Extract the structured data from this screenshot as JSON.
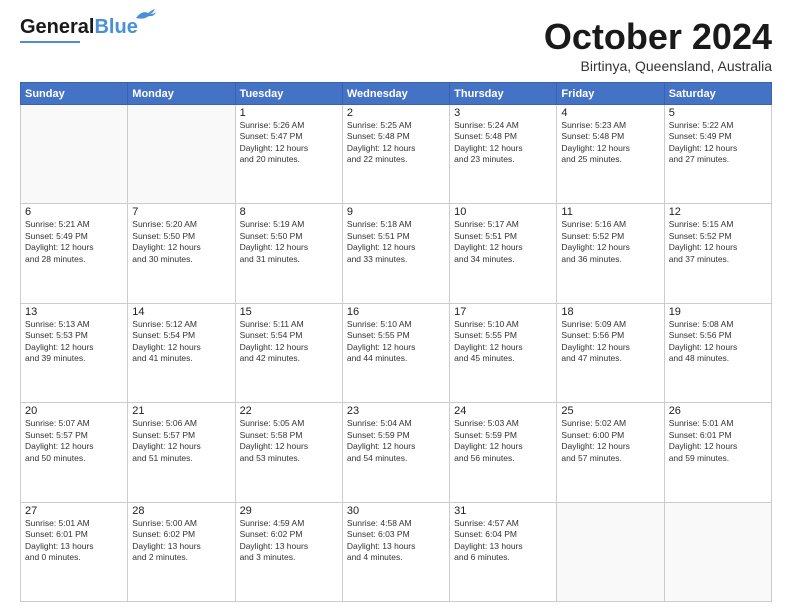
{
  "header": {
    "logo_general": "General",
    "logo_blue": "Blue",
    "month_title": "October 2024",
    "location": "Birtinya, Queensland, Australia"
  },
  "days_of_week": [
    "Sunday",
    "Monday",
    "Tuesday",
    "Wednesday",
    "Thursday",
    "Friday",
    "Saturday"
  ],
  "weeks": [
    [
      {
        "day": "",
        "info": ""
      },
      {
        "day": "",
        "info": ""
      },
      {
        "day": "1",
        "info": "Sunrise: 5:26 AM\nSunset: 5:47 PM\nDaylight: 12 hours\nand 20 minutes."
      },
      {
        "day": "2",
        "info": "Sunrise: 5:25 AM\nSunset: 5:48 PM\nDaylight: 12 hours\nand 22 minutes."
      },
      {
        "day": "3",
        "info": "Sunrise: 5:24 AM\nSunset: 5:48 PM\nDaylight: 12 hours\nand 23 minutes."
      },
      {
        "day": "4",
        "info": "Sunrise: 5:23 AM\nSunset: 5:48 PM\nDaylight: 12 hours\nand 25 minutes."
      },
      {
        "day": "5",
        "info": "Sunrise: 5:22 AM\nSunset: 5:49 PM\nDaylight: 12 hours\nand 27 minutes."
      }
    ],
    [
      {
        "day": "6",
        "info": "Sunrise: 5:21 AM\nSunset: 5:49 PM\nDaylight: 12 hours\nand 28 minutes."
      },
      {
        "day": "7",
        "info": "Sunrise: 5:20 AM\nSunset: 5:50 PM\nDaylight: 12 hours\nand 30 minutes."
      },
      {
        "day": "8",
        "info": "Sunrise: 5:19 AM\nSunset: 5:50 PM\nDaylight: 12 hours\nand 31 minutes."
      },
      {
        "day": "9",
        "info": "Sunrise: 5:18 AM\nSunset: 5:51 PM\nDaylight: 12 hours\nand 33 minutes."
      },
      {
        "day": "10",
        "info": "Sunrise: 5:17 AM\nSunset: 5:51 PM\nDaylight: 12 hours\nand 34 minutes."
      },
      {
        "day": "11",
        "info": "Sunrise: 5:16 AM\nSunset: 5:52 PM\nDaylight: 12 hours\nand 36 minutes."
      },
      {
        "day": "12",
        "info": "Sunrise: 5:15 AM\nSunset: 5:52 PM\nDaylight: 12 hours\nand 37 minutes."
      }
    ],
    [
      {
        "day": "13",
        "info": "Sunrise: 5:13 AM\nSunset: 5:53 PM\nDaylight: 12 hours\nand 39 minutes."
      },
      {
        "day": "14",
        "info": "Sunrise: 5:12 AM\nSunset: 5:54 PM\nDaylight: 12 hours\nand 41 minutes."
      },
      {
        "day": "15",
        "info": "Sunrise: 5:11 AM\nSunset: 5:54 PM\nDaylight: 12 hours\nand 42 minutes."
      },
      {
        "day": "16",
        "info": "Sunrise: 5:10 AM\nSunset: 5:55 PM\nDaylight: 12 hours\nand 44 minutes."
      },
      {
        "day": "17",
        "info": "Sunrise: 5:10 AM\nSunset: 5:55 PM\nDaylight: 12 hours\nand 45 minutes."
      },
      {
        "day": "18",
        "info": "Sunrise: 5:09 AM\nSunset: 5:56 PM\nDaylight: 12 hours\nand 47 minutes."
      },
      {
        "day": "19",
        "info": "Sunrise: 5:08 AM\nSunset: 5:56 PM\nDaylight: 12 hours\nand 48 minutes."
      }
    ],
    [
      {
        "day": "20",
        "info": "Sunrise: 5:07 AM\nSunset: 5:57 PM\nDaylight: 12 hours\nand 50 minutes."
      },
      {
        "day": "21",
        "info": "Sunrise: 5:06 AM\nSunset: 5:57 PM\nDaylight: 12 hours\nand 51 minutes."
      },
      {
        "day": "22",
        "info": "Sunrise: 5:05 AM\nSunset: 5:58 PM\nDaylight: 12 hours\nand 53 minutes."
      },
      {
        "day": "23",
        "info": "Sunrise: 5:04 AM\nSunset: 5:59 PM\nDaylight: 12 hours\nand 54 minutes."
      },
      {
        "day": "24",
        "info": "Sunrise: 5:03 AM\nSunset: 5:59 PM\nDaylight: 12 hours\nand 56 minutes."
      },
      {
        "day": "25",
        "info": "Sunrise: 5:02 AM\nSunset: 6:00 PM\nDaylight: 12 hours\nand 57 minutes."
      },
      {
        "day": "26",
        "info": "Sunrise: 5:01 AM\nSunset: 6:01 PM\nDaylight: 12 hours\nand 59 minutes."
      }
    ],
    [
      {
        "day": "27",
        "info": "Sunrise: 5:01 AM\nSunset: 6:01 PM\nDaylight: 13 hours\nand 0 minutes."
      },
      {
        "day": "28",
        "info": "Sunrise: 5:00 AM\nSunset: 6:02 PM\nDaylight: 13 hours\nand 2 minutes."
      },
      {
        "day": "29",
        "info": "Sunrise: 4:59 AM\nSunset: 6:02 PM\nDaylight: 13 hours\nand 3 minutes."
      },
      {
        "day": "30",
        "info": "Sunrise: 4:58 AM\nSunset: 6:03 PM\nDaylight: 13 hours\nand 4 minutes."
      },
      {
        "day": "31",
        "info": "Sunrise: 4:57 AM\nSunset: 6:04 PM\nDaylight: 13 hours\nand 6 minutes."
      },
      {
        "day": "",
        "info": ""
      },
      {
        "day": "",
        "info": ""
      }
    ]
  ]
}
